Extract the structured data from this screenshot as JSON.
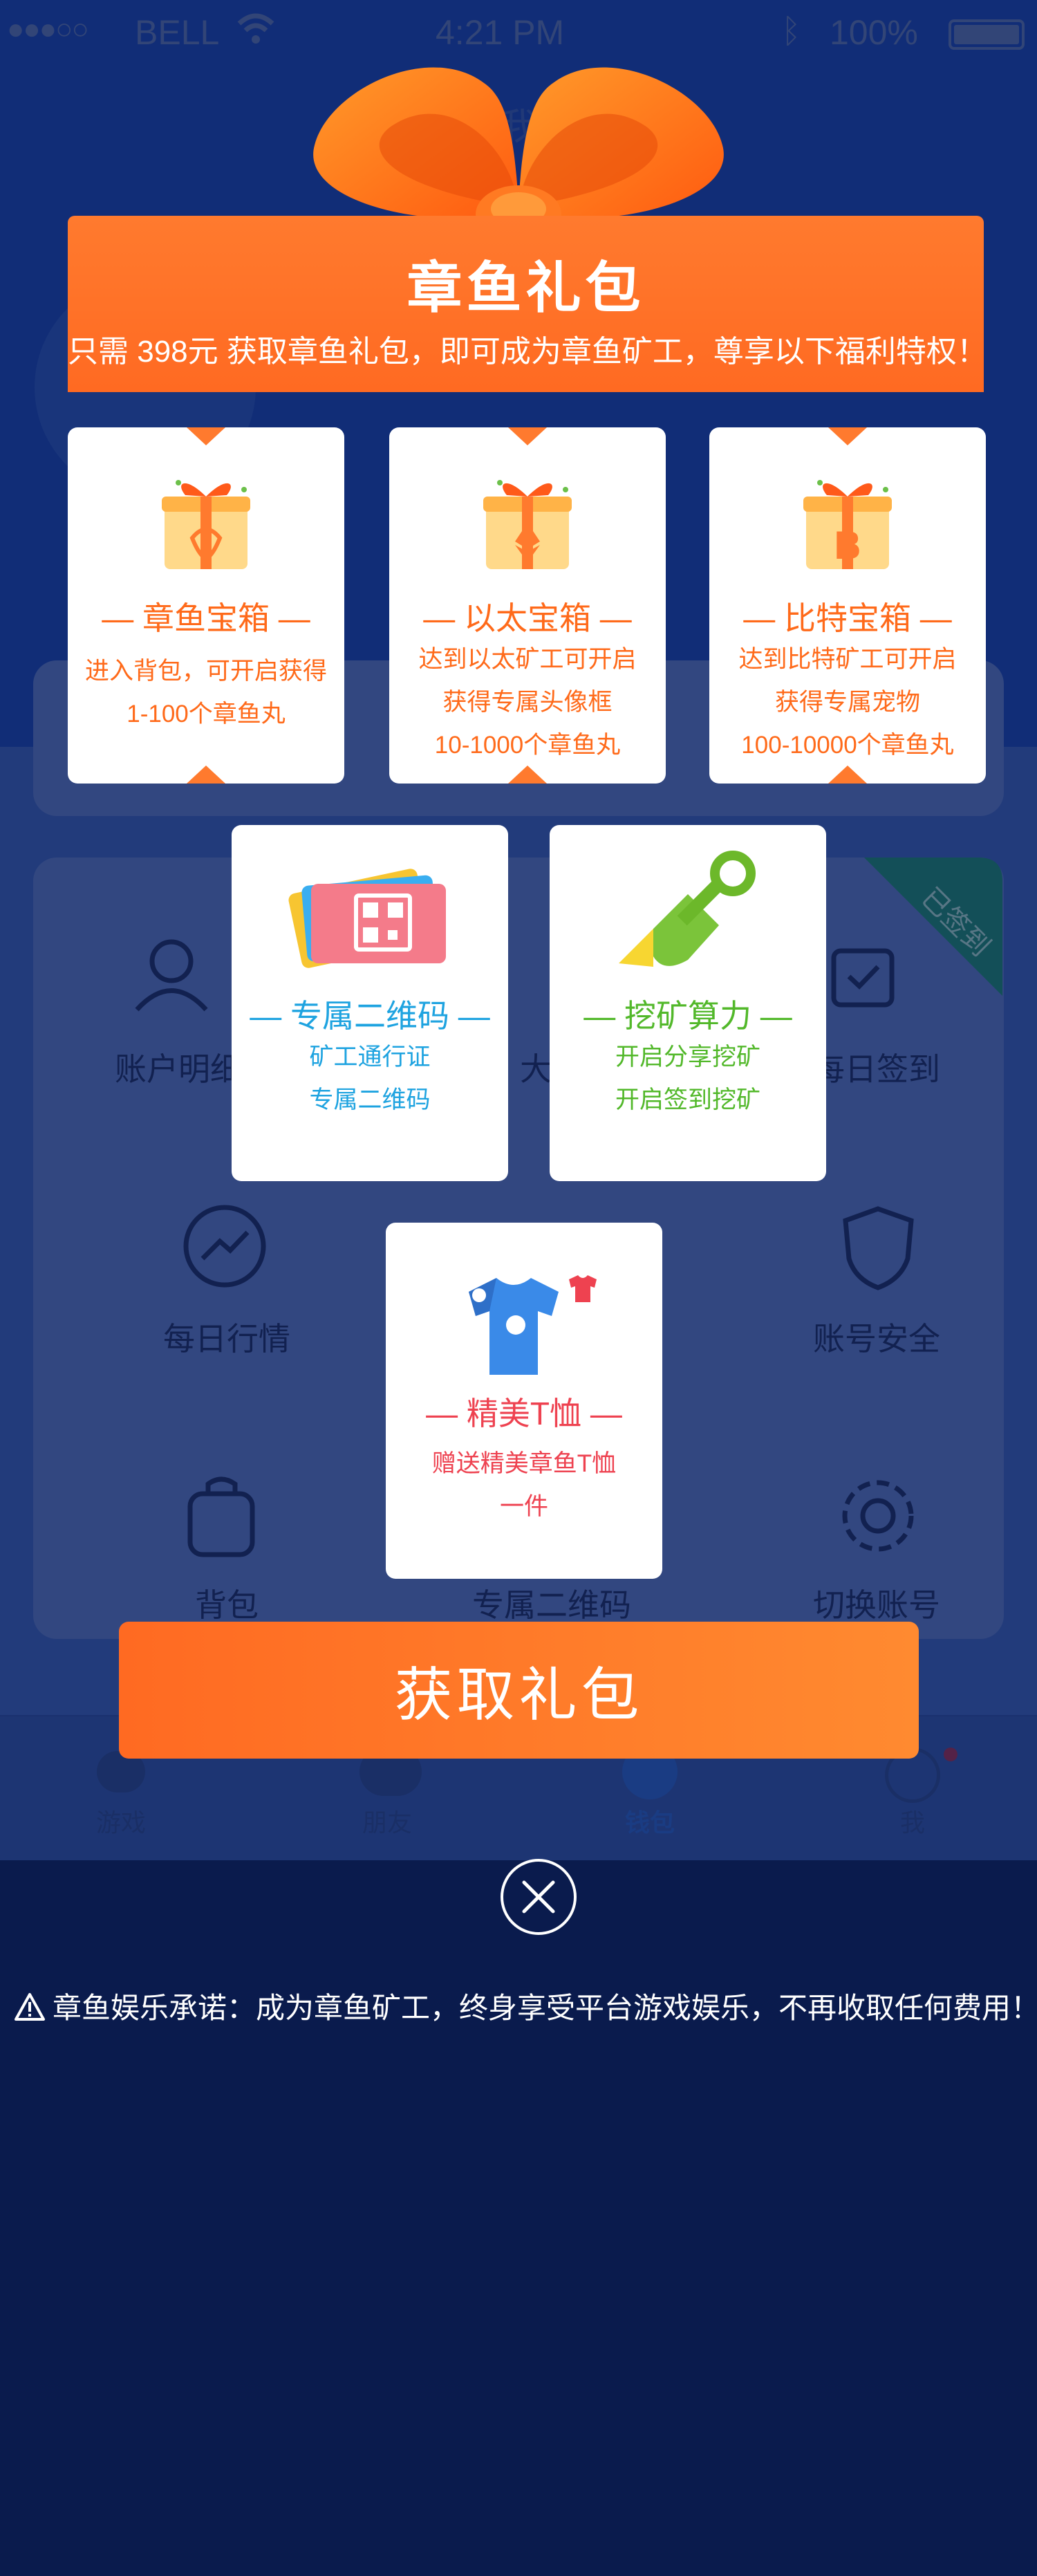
{
  "status_bar": {
    "carrier": "BELL",
    "time": "4:21 PM",
    "battery": "100%"
  },
  "background": {
    "header_title": "我",
    "grid_items": [
      "账户明细",
      "大礼",
      "每日签到",
      "每日行情",
      "账号安全",
      "背包",
      "专属二维码",
      "切换账号"
    ],
    "signed_badge": "已签到",
    "tabs": [
      "游戏",
      "朋友",
      "钱包",
      "我"
    ]
  },
  "modal": {
    "title": "章鱼礼包",
    "subtitle": "只需 398元 获取章鱼礼包，即可成为章鱼矿工，尊享以下福利特权！",
    "cards": [
      {
        "title": "— 章鱼宝箱 —",
        "desc_1": "进入背包，可开启获得",
        "desc_2": "1-100个章鱼丸",
        "desc_3": ""
      },
      {
        "title": "— 以太宝箱 —",
        "desc_1": "达到以太矿工可开启",
        "desc_2": "获得专属头像框",
        "desc_3": "10-1000个章鱼丸"
      },
      {
        "title": "— 比特宝箱 —",
        "desc_1": "达到比特矿工可开启",
        "desc_2": "获得专属宠物",
        "desc_3": "100-10000个章鱼丸"
      },
      {
        "title": "— 专属二维码 —",
        "desc_1": "矿工通行证",
        "desc_2": "专属二维码",
        "desc_3": ""
      },
      {
        "title": "— 挖矿算力 —",
        "desc_1": "开启分享挖矿",
        "desc_2": "开启签到挖矿",
        "desc_3": ""
      },
      {
        "title": "— 精美T恤 —",
        "desc_1": "赠送精美章鱼T恤",
        "desc_2": "一件",
        "desc_3": ""
      }
    ],
    "claim_button": "获取礼包",
    "promise": "章鱼娱乐承诺：成为章鱼矿工，终身享受平台游戏娱乐，不再收取任何费用！"
  },
  "colors": {
    "accent_orange": "#ff6a22",
    "blue_text": "#1ea3e0",
    "green_text": "#52b82a",
    "red_text": "#ee4250"
  }
}
